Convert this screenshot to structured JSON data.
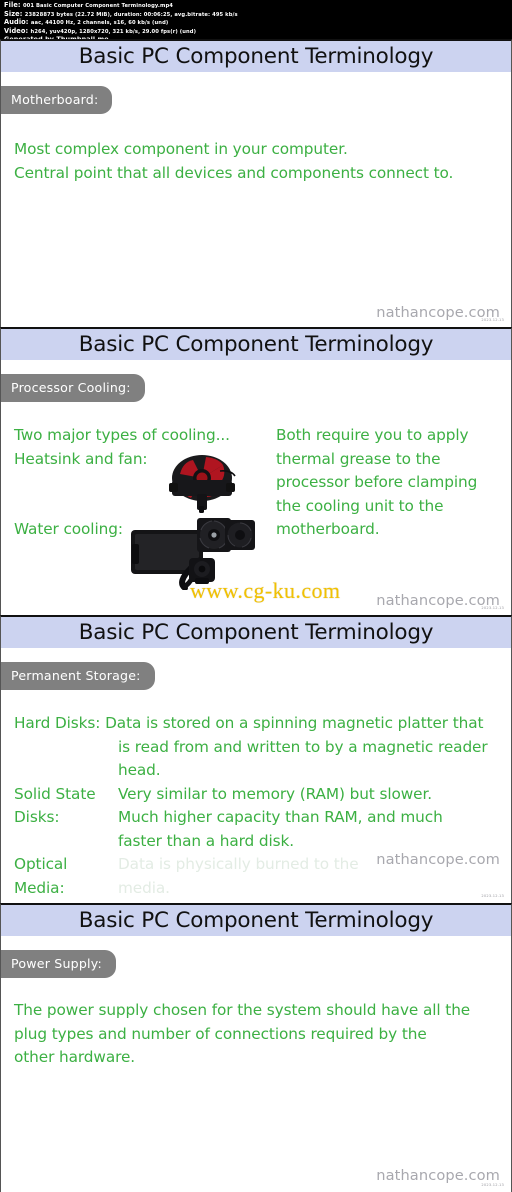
{
  "media_info": {
    "file_label": "File:",
    "file_value": "001 Basic Computer Component Terminology.mp4",
    "size_label": "Size:",
    "size_value": "23828873 bytes (22.72 MiB), duration: 00:06:25, avg.bitrate: 495 kb/s",
    "audio_label": "Audio:",
    "audio_value": "aac, 44100 Hz, 2 channels, s16, 60 kb/s (und)",
    "video_label": "Video:",
    "video_value": "h264, yuv420p, 1280x720, 321 kb/s, 29.00 fps(r) (und)",
    "generator": "Generated by Thumbnail me"
  },
  "colors": {
    "title_band": "#ccd3f0",
    "pill_gray": "#808080",
    "body_green": "#3cb043",
    "faded_green": "#e3ece4",
    "watermark_gray": "#a8a8ae",
    "cgku_gold": "#f2c200",
    "background": "#ffffff",
    "header_black": "#000000"
  },
  "slides": [
    {
      "title": "Basic PC Component Terminology",
      "pill": "Motherboard:",
      "lines": [
        "Most complex component in your computer.",
        "Central point that all devices and components connect to."
      ],
      "watermark": "nathancope.com",
      "watermark_tiny": "2023.12.13"
    },
    {
      "title": "Basic PC Component Terminology",
      "pill": "Processor Cooling:",
      "left_lines": [
        "Two major types of cooling...",
        "Heatsink and fan:"
      ],
      "left_lower": "Water cooling:",
      "right_lines": [
        "Both require you to apply",
        "thermal grease to the",
        "processor before clamping",
        "the cooling unit to the",
        "motherboard."
      ],
      "images": [
        "cpu-heatsink-fan-photo",
        "water-cooling-radiator-photo"
      ],
      "overlay_watermark": "www.cg-ku.com",
      "watermark": "nathancope.com",
      "watermark_tiny": "2023.12.13"
    },
    {
      "title": "Basic PC Component Terminology",
      "pill": "Permanent Storage:",
      "rows": [
        {
          "label": "Hard Disks:",
          "inline": true,
          "values": [
            "Data is stored on a spinning magnetic platter that",
            "is read from and written to by a magnetic reader",
            "head."
          ],
          "faded": false
        },
        {
          "label": "Solid State",
          "label2": "Disks:",
          "inline": false,
          "values": [
            "Very similar to memory (RAM) but slower.",
            "Much higher capacity than RAM, and much",
            "faster than a hard disk."
          ],
          "faded": false
        },
        {
          "label": "Optical",
          "label2": "Media:",
          "inline": false,
          "values": [
            "Data is physically burned to the",
            "media."
          ],
          "faded": true
        }
      ],
      "watermark": "nathancope.com",
      "watermark_tiny": "2023.12.13"
    },
    {
      "title": "Basic PC Component Terminology",
      "pill": "Power Supply:",
      "lines": [
        "The power supply chosen for the system should have all the",
        "plug types and number of connections required by the",
        "other hardware."
      ],
      "watermark": "nathancope.com",
      "watermark_tiny": "2023.12.13"
    }
  ]
}
